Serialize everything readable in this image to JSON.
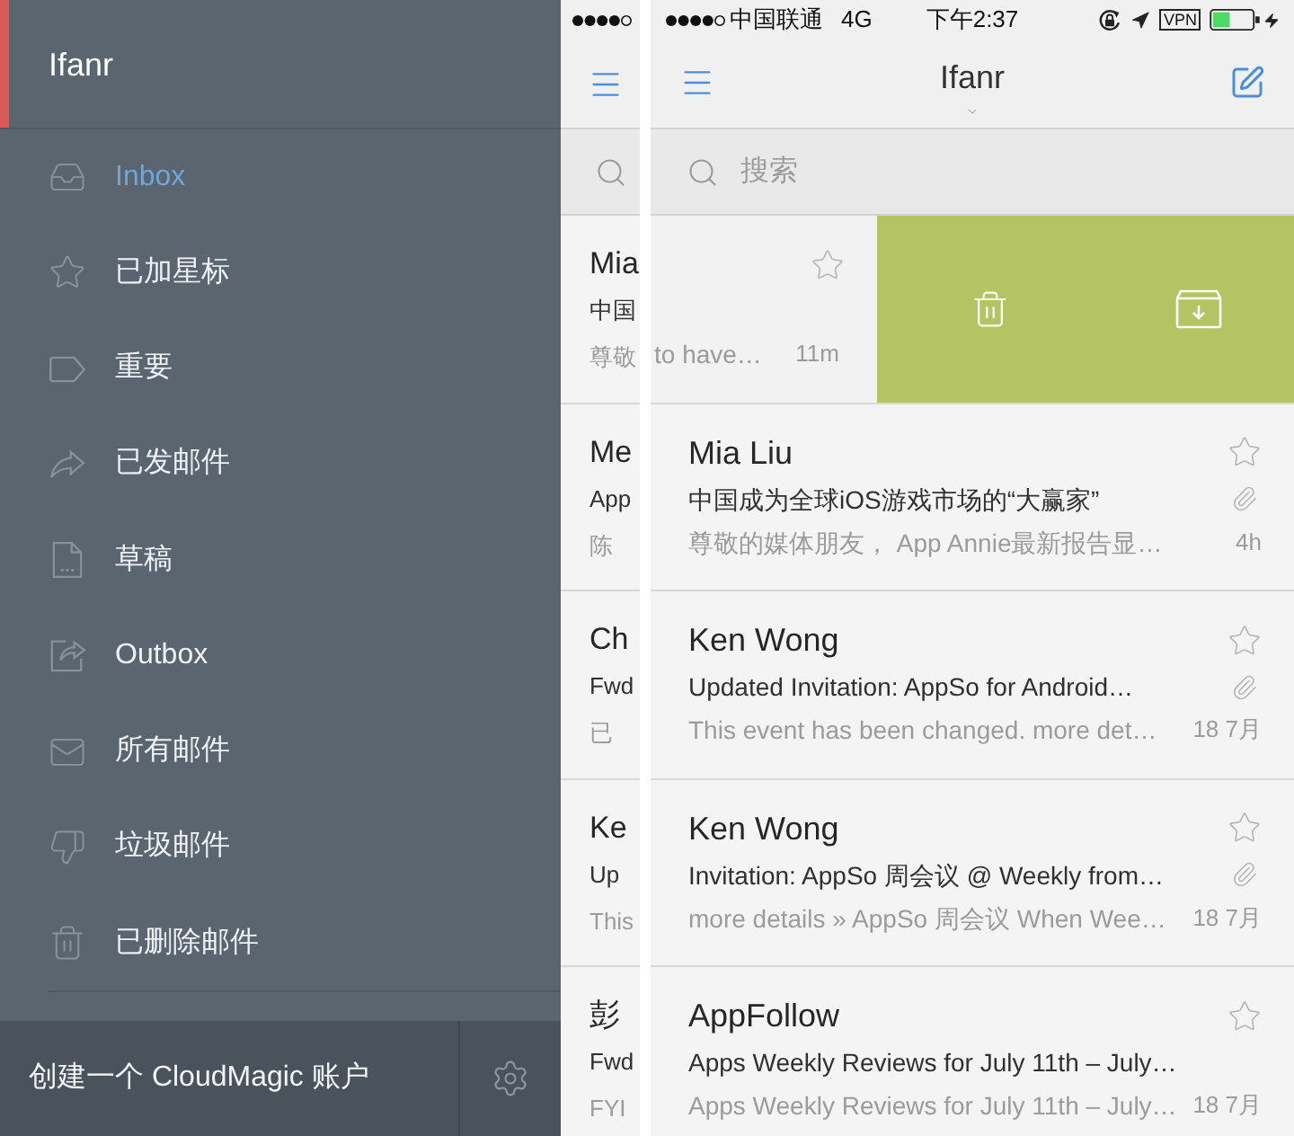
{
  "left_screen": {
    "sidebar": {
      "account": "Ifanr",
      "items": [
        {
          "label": "Inbox",
          "selected": true
        },
        {
          "label": "已加星标",
          "selected": false
        },
        {
          "label": "重要",
          "selected": false
        },
        {
          "label": "已发邮件",
          "selected": false
        },
        {
          "label": "草稿",
          "selected": false
        },
        {
          "label": "Outbox",
          "selected": false
        },
        {
          "label": "所有邮件",
          "selected": false
        },
        {
          "label": "垃圾邮件",
          "selected": false
        },
        {
          "label": "已删除邮件",
          "selected": false
        }
      ],
      "footer": {
        "create_account": "创建一个 CloudMagic 账户"
      }
    },
    "list_behind": {
      "rows": [
        {
          "sender": "Mia",
          "subject": "中国",
          "preview": "尊敬"
        },
        {
          "sender": "Me",
          "subject": "App",
          "preview": "陈"
        },
        {
          "sender": "Ch",
          "subject": "Fwd",
          "preview": "已"
        },
        {
          "sender": "Ke",
          "subject": "Up",
          "preview": "This"
        },
        {
          "sender": "彭",
          "subject": "Fwd",
          "preview": "FYI"
        }
      ]
    }
  },
  "right_screen": {
    "status_bar": {
      "carrier": "中国联通",
      "network": "4G",
      "time": "下午2:37",
      "vpn": "VPN"
    },
    "nav_bar": {
      "title": "Ifanr"
    },
    "search": {
      "placeholder": "搜索"
    },
    "swiped_row": {
      "preview": "to have…",
      "time": "11m",
      "starred": false
    },
    "rows": [
      {
        "sender": "Mia Liu",
        "subject": "中国成为全球iOS游戏市场的“大赢家”",
        "preview": "尊敬的媒体朋友， App Annie最新报告显…",
        "time": "4h",
        "attachment": true,
        "starred": false
      },
      {
        "sender": "Ken Wong",
        "subject": "Updated Invitation: AppSo for Android…",
        "preview": "This event has been changed. more det…",
        "time": "18 7月",
        "attachment": true,
        "starred": false
      },
      {
        "sender": "Ken Wong",
        "subject": "Invitation: AppSo 周会议 @ Weekly from…",
        "preview": "more details » AppSo 周会议 When Wee…",
        "time": "18 7月",
        "attachment": true,
        "starred": false
      },
      {
        "sender": "AppFollow",
        "subject": "Apps Weekly Reviews for July 11th – July…",
        "preview": "Apps Weekly Reviews for July 11th – July…",
        "time": "18 7月",
        "attachment": false,
        "starred": false
      }
    ]
  }
}
